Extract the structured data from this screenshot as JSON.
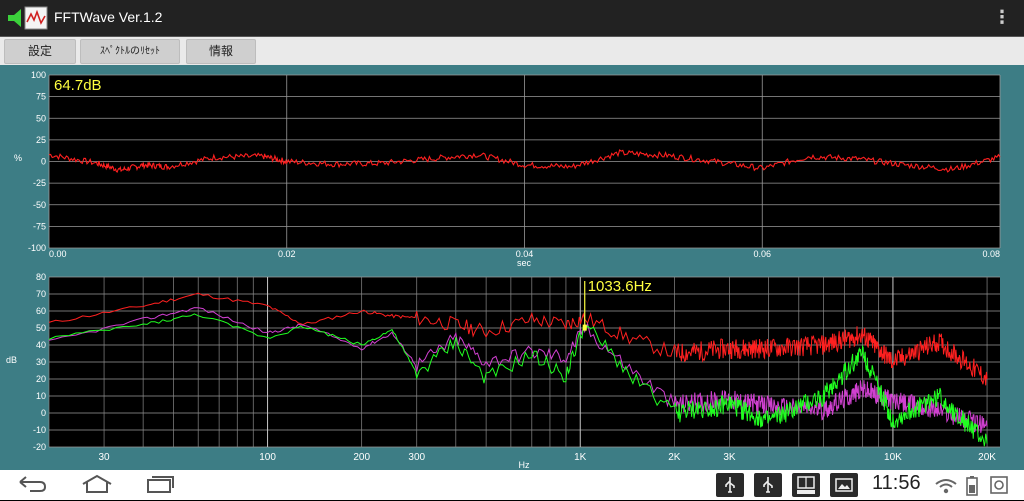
{
  "app": {
    "title": "FFTWave Ver.1.2",
    "icon": "speaker-waveform-icon"
  },
  "toolbar": {
    "settings": "設定",
    "reset": "ｽﾍﾟｸﾄﾙのﾘｾｯﾄ",
    "info": "情報"
  },
  "wave": {
    "readout": "64.7dB",
    "ylabel": "%",
    "xlabel": "sec",
    "yticks": [
      "100",
      "75",
      "50",
      "25",
      "0",
      "-25",
      "-50",
      "-75",
      "-100"
    ],
    "xticks": [
      "0.00",
      "0.02",
      "0.04",
      "0.06",
      "0.08"
    ]
  },
  "spectrum": {
    "marker": "1033.6Hz",
    "ylabel": "dB",
    "xlabel": "Hz",
    "yticks": [
      "80",
      "70",
      "60",
      "50",
      "40",
      "30",
      "20",
      "10",
      "0",
      "-10",
      "-20"
    ],
    "xticks": [
      "30",
      "100",
      "200",
      "300",
      "1K",
      "2K",
      "3K",
      "10K",
      "20K"
    ]
  },
  "status": {
    "time": "11:56"
  },
  "chart_data": [
    {
      "type": "line",
      "title": "",
      "xlabel": "sec",
      "ylabel": "%",
      "xlim": [
        0,
        0.08
      ],
      "ylim": [
        -100,
        100
      ],
      "grid": true,
      "annotation": "64.7dB",
      "series": [
        {
          "color": "#ff2020",
          "x": [
            0,
            0.004,
            0.006,
            0.008,
            0.01,
            0.014,
            0.018,
            0.02,
            0.024,
            0.028,
            0.032,
            0.036,
            0.04,
            0.044,
            0.048,
            0.052,
            0.056,
            0.06,
            0.064,
            0.068,
            0.072,
            0.076,
            0.08
          ],
          "values": [
            8,
            -2,
            -10,
            -4,
            -6,
            5,
            6,
            0,
            -3,
            -2,
            3,
            8,
            -4,
            -6,
            10,
            7,
            0,
            -8,
            6,
            3,
            -4,
            -9,
            5
          ]
        }
      ]
    },
    {
      "type": "line",
      "title": "",
      "xlabel": "Hz",
      "ylabel": "dB",
      "xscale": "log",
      "xlim": [
        20,
        22000
      ],
      "ylim": [
        -20,
        80
      ],
      "grid": true,
      "marker_label": "1033.6Hz",
      "series": [
        {
          "color": "#ff2020",
          "x": [
            20,
            40,
            60,
            100,
            130,
            200,
            250,
            300,
            400,
            500,
            700,
            900,
            1033,
            1400,
            2000,
            3000,
            4000,
            6000,
            8000,
            10000,
            14000,
            20000
          ],
          "values": [
            53,
            63,
            70,
            63,
            52,
            60,
            57,
            56,
            52,
            48,
            55,
            52,
            56,
            45,
            35,
            38,
            38,
            40,
            46,
            30,
            42,
            20
          ]
        },
        {
          "color": "#d040d0",
          "x": [
            20,
            40,
            60,
            100,
            130,
            200,
            250,
            300,
            400,
            500,
            700,
            900,
            1033,
            1400,
            2000,
            3000,
            4000,
            6000,
            8000,
            10000,
            14000,
            20000
          ],
          "values": [
            42,
            55,
            62,
            47,
            52,
            38,
            47,
            28,
            44,
            30,
            36,
            33,
            50,
            28,
            5,
            8,
            4,
            2,
            14,
            7,
            2,
            -8
          ]
        },
        {
          "color": "#20ff20",
          "x": [
            20,
            40,
            60,
            100,
            130,
            200,
            250,
            300,
            400,
            500,
            700,
            900,
            1033,
            1400,
            2000,
            3000,
            4000,
            6000,
            8000,
            10000,
            14000,
            20000
          ],
          "values": [
            44,
            52,
            58,
            44,
            51,
            40,
            49,
            23,
            42,
            20,
            34,
            22,
            52,
            25,
            0,
            5,
            -5,
            10,
            36,
            -5,
            10,
            -18
          ]
        }
      ]
    }
  ]
}
